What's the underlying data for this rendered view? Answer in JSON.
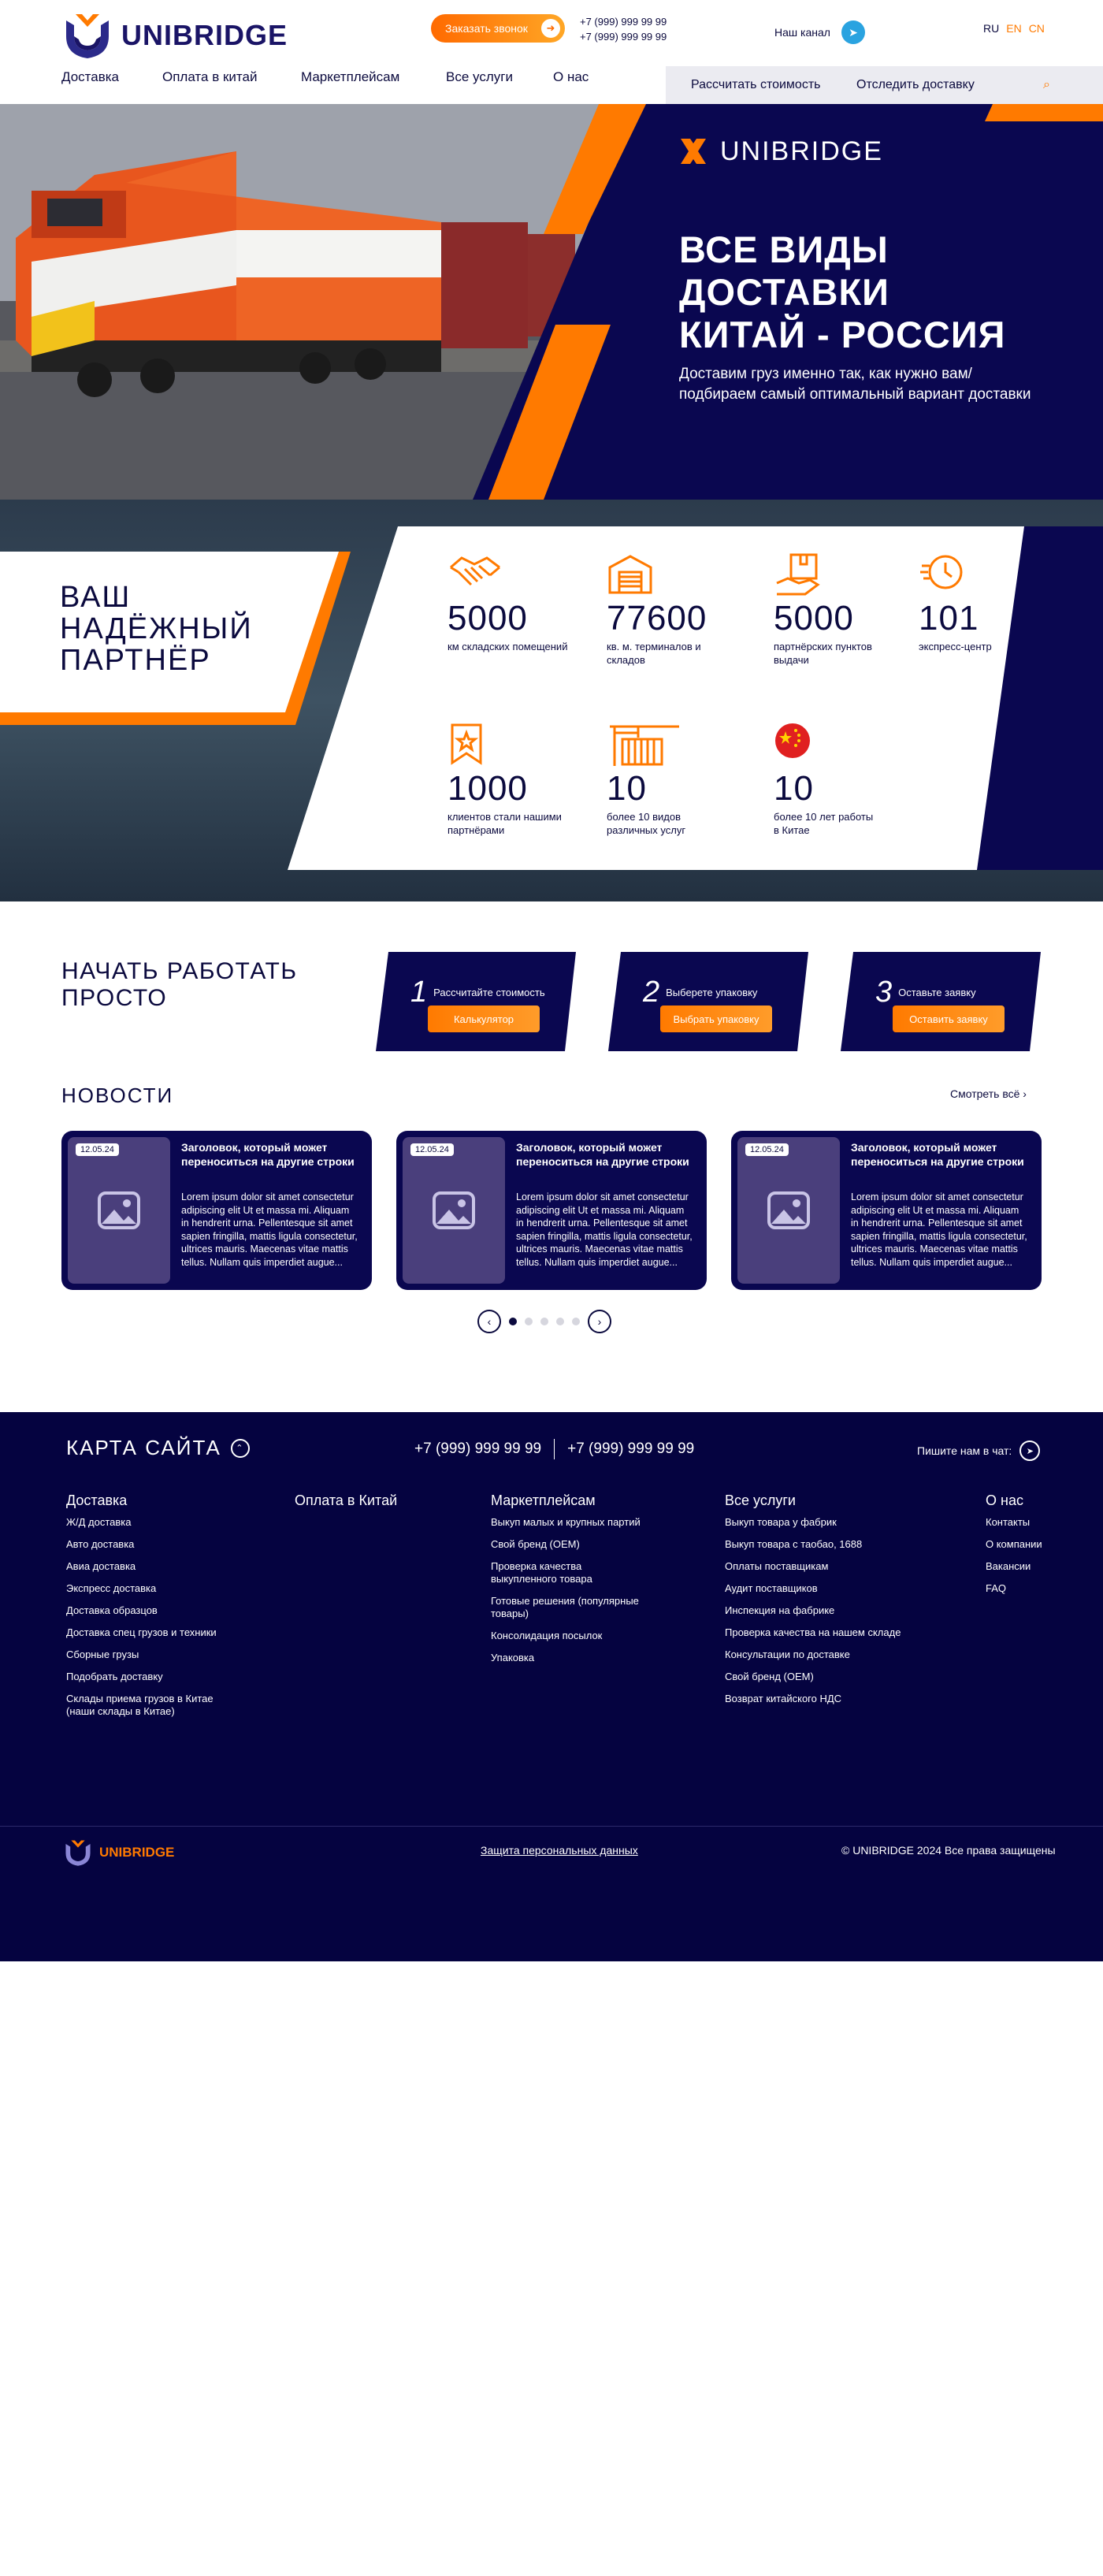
{
  "header": {
    "brand": "UNIBRIDGE",
    "call_button": "Заказать звонок",
    "phones": [
      "+7 (999) 999 99 99",
      "+7 (999) 999 99 99"
    ],
    "channel_label": "Наш канал",
    "languages": [
      "RU",
      "EN",
      "CN"
    ],
    "nav": [
      "Доставка",
      "Оплата в китай",
      "Маркетплейсам",
      "Все услуги",
      "О нас"
    ],
    "subbar": [
      "Рассчитать стоимость",
      "Отследить доставку"
    ]
  },
  "hero": {
    "brand": "UNIBRIDGE",
    "title_lines": [
      "ВСЕ ВИДЫ",
      "ДОСТАВКИ",
      "КИТАЙ - РОССИЯ"
    ],
    "subtitle_lines": [
      "Доставим груз именно так, как нужно вам/",
      "подбираем самый оптимальный вариант доставки"
    ]
  },
  "partner": {
    "title_lines": [
      "ВАШ",
      "НАДЁЖНЫЙ",
      "ПАРТНЁР"
    ],
    "stats": [
      {
        "num": "5000",
        "label": "км складских помещений",
        "icon": "handshake-icon"
      },
      {
        "num": "77600",
        "label": "кв. м. терминалов и складов",
        "icon": "warehouse-icon"
      },
      {
        "num": "5000",
        "label": "партнёрских пунктов выдачи",
        "icon": "parcel-icon"
      },
      {
        "num": "101",
        "label": "экспресс-центр",
        "icon": "clock-icon"
      },
      {
        "num": "1000",
        "label": "клиентов стали нашими партнёрами",
        "icon": "badge-icon"
      },
      {
        "num": "10",
        "label": "более 10 видов различных услуг",
        "icon": "crane-icon"
      },
      {
        "num": "10",
        "label": "более 10 лет работы в Китае",
        "icon": "china-flag-icon"
      }
    ]
  },
  "start": {
    "title_lines": [
      "НАЧАТЬ РАБОТАТЬ",
      "ПРОСТО"
    ],
    "steps": [
      {
        "n": "1",
        "label": "Рассчитайте стоимость",
        "button": "Калькулятор"
      },
      {
        "n": "2",
        "label": "Выберете упаковку",
        "button": "Выбрать упаковку"
      },
      {
        "n": "3",
        "label": "Оставьте заявку",
        "button": "Оставить заявку"
      }
    ]
  },
  "news": {
    "title": "НОВОСТИ",
    "see_all": "Смотреть всё",
    "cards": [
      {
        "date": "12.05.24",
        "title": "Заголовок, который может переноситься на другие строки",
        "body": "Lorem ipsum dolor sit amet consectetur adipiscing elit Ut et massa mi. Aliquam in hendrerit urna. Pellentesque sit amet sapien fringilla, mattis ligula consectetur, ultrices mauris. Maecenas vitae mattis tellus. Nullam quis imperdiet augue..."
      },
      {
        "date": "12.05.24",
        "title": "Заголовок, который может переноситься на другие строки",
        "body": "Lorem ipsum dolor sit amet consectetur adipiscing elit Ut et massa mi. Aliquam in hendrerit urna. Pellentesque sit amet sapien fringilla, mattis ligula consectetur, ultrices mauris. Maecenas vitae mattis tellus. Nullam quis imperdiet augue..."
      },
      {
        "date": "12.05.24",
        "title": "Заголовок, который может переноситься на другие строки",
        "body": "Lorem ipsum dolor sit amet consectetur adipiscing elit Ut et massa mi. Aliquam in hendrerit urna. Pellentesque sit amet sapien fringilla, mattis ligula consectetur, ultrices mauris. Maecenas vitae mattis tellus. Nullam quis imperdiet augue..."
      }
    ],
    "active_page": 1
  },
  "footer": {
    "sitemap": "КАРТА САЙТА",
    "phones": [
      "+7 (999) 999 99 99",
      "+7 (999) 999 99 99"
    ],
    "chat": "Пишите нам в чат:",
    "columns": [
      {
        "title": "Доставка",
        "items": [
          "Ж/Д доставка",
          "Авто доставка",
          "Авиа доставка",
          "Экспресс доставка",
          "Доставка образцов",
          "Доставка спец грузов и техники",
          "Сборные грузы",
          "Подобрать доставку",
          "Склады приема грузов в Китае (наши склады в Китае)"
        ]
      },
      {
        "title": "Оплата в Китай",
        "items": []
      },
      {
        "title": "Маркетплейсам",
        "items": [
          "Выкуп малых и крупных партий",
          "Свой бренд (OEM)",
          "Проверка качества выкупленного товара",
          "Готовые решения (популярные товары)",
          "Консолидация посылок",
          "Упаковка"
        ]
      },
      {
        "title": "Все услуги",
        "items": [
          "Выкуп товара у фабрик",
          "Выкуп товара с таобао, 1688",
          "Оплаты поставщикам",
          "Аудит поставщиков",
          "Инспекция на фабрике",
          "Проверка качества на нашем складе",
          "Консультации по доставке",
          "Свой бренд (OEM)",
          "Возврат китайского НДС"
        ]
      },
      {
        "title": "О нас",
        "items": [
          "Контакты",
          "О компании",
          "Вакансии",
          "FAQ"
        ]
      }
    ],
    "brand": "UNIBRIDGE",
    "privacy": "Защита персональных данных",
    "copyright": "© UNIBRIDGE 2024 Все права защищены"
  },
  "colors": {
    "navy": "#0a0750",
    "orange": "#ff7a00",
    "text": "#0b0a3e"
  }
}
